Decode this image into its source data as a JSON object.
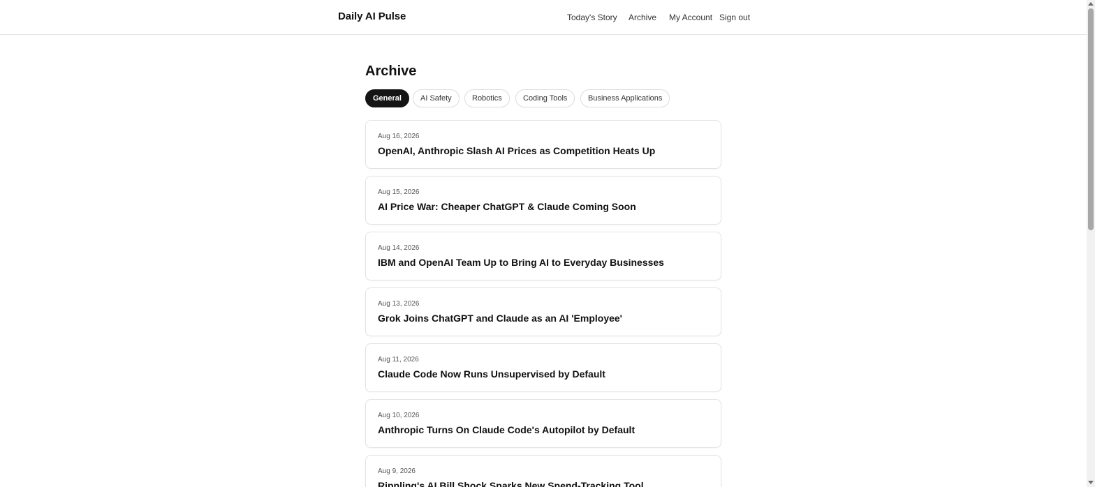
{
  "header": {
    "brand": "Daily AI Pulse",
    "nav": [
      "Today's Story",
      "Archive",
      "My Account",
      "Sign out"
    ]
  },
  "main": {
    "title": "Archive",
    "tabs": [
      {
        "label": "General",
        "active": true
      },
      {
        "label": "AI Safety",
        "active": false
      },
      {
        "label": "Robotics",
        "active": false
      },
      {
        "label": "Coding Tools",
        "active": false
      },
      {
        "label": "Business Applications",
        "active": false
      }
    ],
    "articles": [
      {
        "date": "Aug 16, 2026",
        "title": "OpenAI, Anthropic Slash AI Prices as Competition Heats Up"
      },
      {
        "date": "Aug 15, 2026",
        "title": "AI Price War: Cheaper ChatGPT & Claude Coming Soon"
      },
      {
        "date": "Aug 14, 2026",
        "title": "IBM and OpenAI Team Up to Bring AI to Everyday Businesses"
      },
      {
        "date": "Aug 13, 2026",
        "title": "Grok Joins ChatGPT and Claude as an AI 'Employee'"
      },
      {
        "date": "Aug 11, 2026",
        "title": "Claude Code Now Runs Unsupervised by Default"
      },
      {
        "date": "Aug 10, 2026",
        "title": "Anthropic Turns On Claude Code's Autopilot by Default"
      },
      {
        "date": "Aug 9, 2026",
        "title": "Rippling's AI Bill Shock Sparks New Spend-Tracking Tool"
      }
    ]
  },
  "colors": {
    "active_tab_bg": "#151515",
    "border": "#e3e3e3",
    "text": "#111111"
  }
}
